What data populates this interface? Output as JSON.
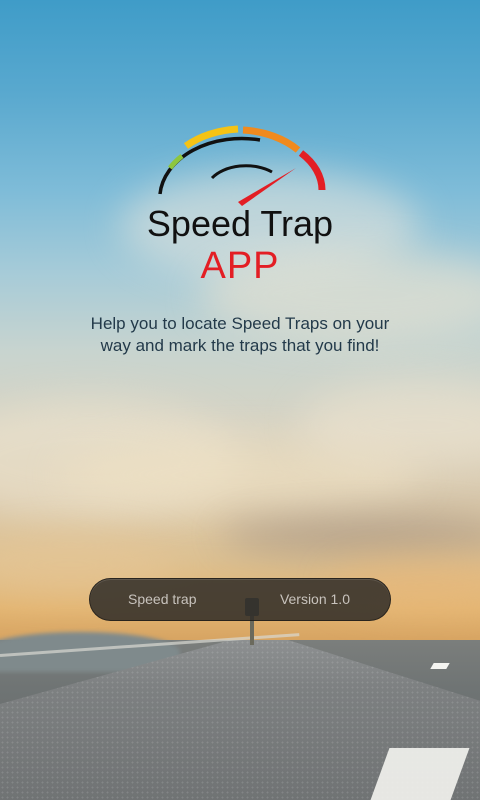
{
  "splash": {
    "title": "Speed Trap",
    "subtitle": "APP",
    "tagline": "Help you to locate Speed Traps on your way and mark the traps that you find!",
    "logo_icon": "speedometer-icon"
  },
  "info_bar": {
    "app_name": "Speed trap",
    "version": "Version 1.0"
  },
  "colors": {
    "title": "#111111",
    "accent": "#e31e24",
    "gauge_yellow": "#f5c315",
    "gauge_orange": "#f08a1e",
    "gauge_red": "#e31e24",
    "tagline": "#233a4a",
    "bar_text": "#c8c3bd"
  }
}
